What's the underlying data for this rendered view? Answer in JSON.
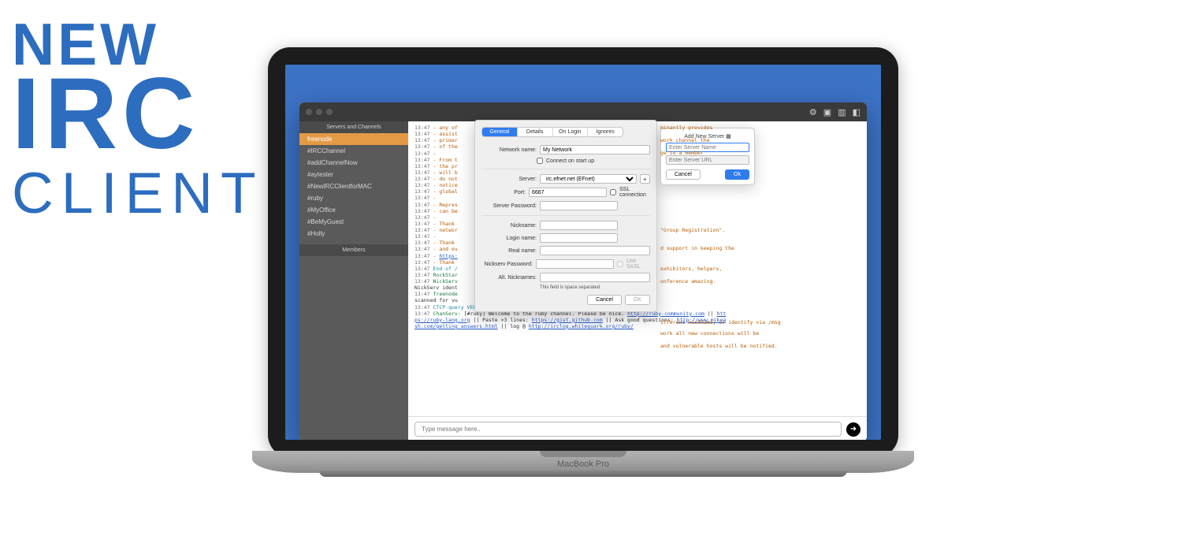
{
  "headline": {
    "line1": "NEW",
    "line2": "IRC",
    "line3": "CLIENT"
  },
  "laptop_label": "MacBook Pro",
  "sidebar": {
    "header": "Servers and Channels",
    "items": [
      {
        "label": "freenode",
        "selected": true
      },
      {
        "label": "#IRCChannel",
        "selected": false
      },
      {
        "label": "#addChannelNow",
        "selected": false
      },
      {
        "label": "#aytester",
        "selected": false
      },
      {
        "label": "#NewIRCClientforMAC",
        "selected": false
      },
      {
        "label": "#ruby",
        "selected": false
      },
      {
        "label": "#MyOffice",
        "selected": false
      },
      {
        "label": "#BeMyGuest",
        "selected": false
      },
      {
        "label": "#Holly",
        "selected": false
      }
    ],
    "members_header": "Members"
  },
  "prefs": {
    "tabs": [
      "General",
      "Details",
      "On Login",
      "Ignores"
    ],
    "active_tab": 0,
    "labels": {
      "network_name": "Network name:",
      "connect_on_start": "Connect on start up",
      "server": "Server:",
      "port": "Port:",
      "ssl": "SSL connection",
      "server_password": "Server Password:",
      "nickname": "Nickname:",
      "login_name": "Login name:",
      "real_name": "Real name:",
      "nickserv_password": "Nickserv Password:",
      "use_sasl": "Use SASL",
      "alt_nicknames": "Alt. Nicknames:",
      "help": "This field is space separated.",
      "cancel": "Cancel",
      "ok": "OK"
    },
    "values": {
      "network_name": "My Network",
      "server_select": "irc.efnet.net (EFnet)",
      "port": "6667"
    }
  },
  "popover": {
    "title": "Add New Server",
    "title_icon": "server-icon",
    "name_placeholder": "Enter Server Name",
    "url_placeholder": "Enter Server URL",
    "cancel": "Cancel",
    "ok": "Ok"
  },
  "chat": {
    "timestamp": "13:47",
    "lines": [
      {
        "type": "motd",
        "text": "- any of"
      },
      {
        "type": "motd",
        "text": "- assist"
      },
      {
        "type": "motd",
        "text": "- primar"
      },
      {
        "type": "motd",
        "text": "- of the"
      },
      {
        "type": "motd",
        "text": "-"
      },
      {
        "type": "motd",
        "text": "- From t"
      },
      {
        "type": "motd",
        "text": "- the pr"
      },
      {
        "type": "motd",
        "text": "- will b"
      },
      {
        "type": "motd",
        "text": "- do not"
      },
      {
        "type": "motd",
        "text": "- notice"
      },
      {
        "type": "motd",
        "text": "- global"
      },
      {
        "type": "motd",
        "text": "-"
      },
      {
        "type": "motd",
        "text": "- Repres"
      },
      {
        "type": "motd",
        "text": "- can be"
      },
      {
        "type": "motd",
        "text": "-"
      },
      {
        "type": "motd",
        "text": "- Thank"
      },
      {
        "type": "motd",
        "text": "- networ"
      },
      {
        "type": "motd",
        "text": "-"
      },
      {
        "type": "motd",
        "text": "- Thank"
      },
      {
        "type": "motd",
        "text": "- and ev"
      },
      {
        "type": "link",
        "prefix": "- ",
        "url": "https:"
      },
      {
        "type": "motd",
        "text": "- Thank"
      },
      {
        "type": "sys",
        "text": "End of /"
      },
      {
        "type": "nick_line",
        "nick": "RockStar"
      },
      {
        "type": "nick_line",
        "nick": "NickServ"
      },
      {
        "type": "plain",
        "text": "NickServ ident"
      },
      {
        "type": "nick_line",
        "nick": "freenode"
      }
    ],
    "right_fragments": [
      "minantly provides",
      "work channel the",
      "ge to a member",
      "\"Group Registration\".",
      "d support in keeping the",
      "exhibitors, helpers,",
      "onference amazing.",
      "ifferent nickname, or identify via /msg",
      "work all new connections will be",
      "and vulnerable hosts will be notified."
    ],
    "bottom_lines": [
      {
        "prefix": "scanned for vu"
      },
      {
        "nick_text": "CTCP-query VERSION from freenode-connect"
      },
      {
        "chanserv_prefix": "ChanServ:",
        "body": " [#ruby] Welcome to the ruby channel. Please be nice. ",
        "link1": "http://ruby-community.com",
        "sep1": " || ",
        "link2": "htt"
      },
      {
        "cont1": "ps://ruby-lang.org",
        "mid": " || Paste >3 lines: ",
        "link3": "https://gist.github.com",
        "mid2": " || Ask good questions: ",
        "link4": "http://www.mikea"
      },
      {
        "cont2": "sh.com/getting_answers.html",
        "mid3": " || log @ ",
        "link5": "http://irclog.whitequark.org/ruby/"
      }
    ],
    "input_placeholder": "Type message here.."
  },
  "titlebar_icons": [
    "settings-icon",
    "chat-icon",
    "sidebar-icon",
    "panel-icon"
  ]
}
